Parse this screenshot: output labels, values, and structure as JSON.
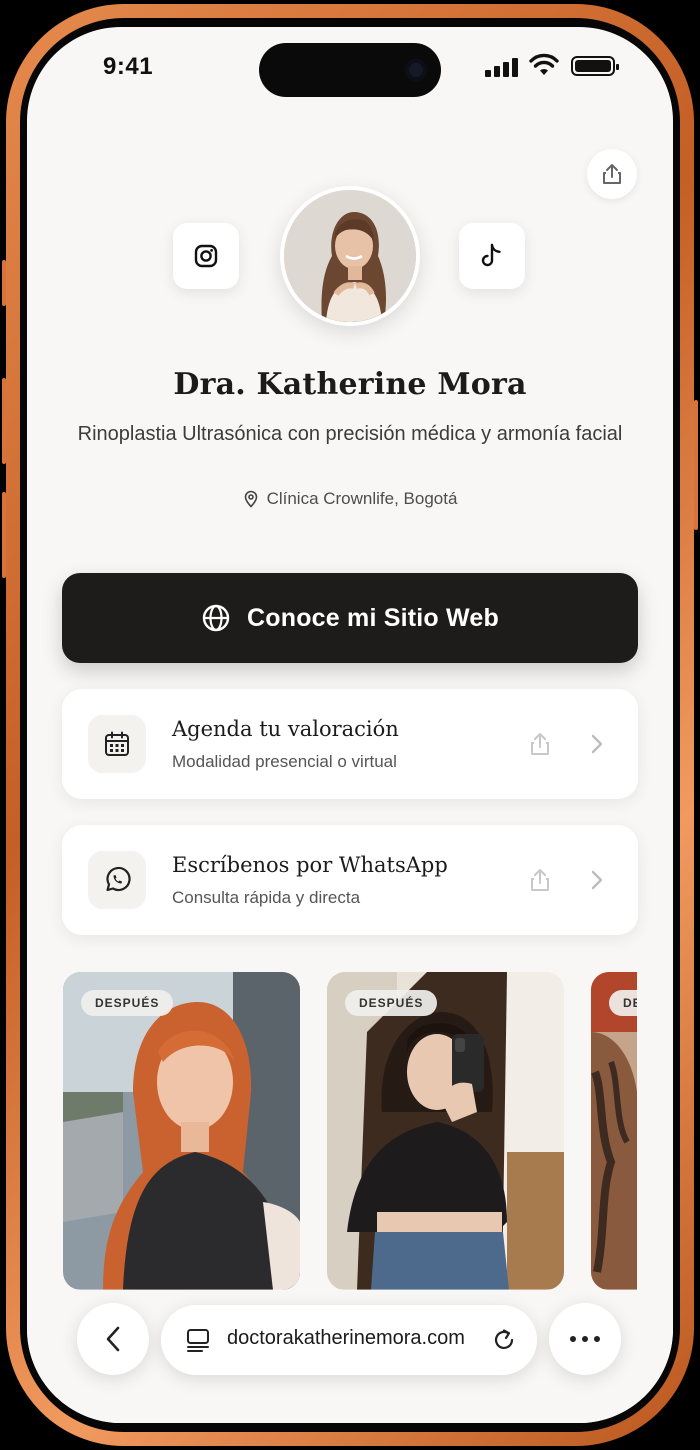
{
  "status_bar": {
    "time": "9:41"
  },
  "profile": {
    "name": "Dra. Katherine Mora",
    "subtitle": "Rinoplastia Ultrasónica con precisión médica y armonía facial",
    "location": "Clínica Crownlife, Bogotá",
    "social": [
      "instagram-icon",
      "tiktok-icon"
    ]
  },
  "cta": {
    "label": "Conoce mi Sitio Web",
    "icon": "globe-icon"
  },
  "cards": [
    {
      "title": "Agenda tu valoración",
      "subtitle": "Modalidad presencial o virtual",
      "icon": "calendar-icon"
    },
    {
      "title": "Escríbenos por WhatsApp",
      "subtitle": "Consulta rápida y directa",
      "icon": "whatsapp-icon"
    }
  ],
  "gallery": {
    "badge": "DESPUÉS"
  },
  "browser": {
    "url": "doctorakatherinemora.com"
  },
  "colors": {
    "frame": "#d8743a",
    "cta_bg": "#1d1c1b",
    "page_bg": "#f8f7f5"
  }
}
